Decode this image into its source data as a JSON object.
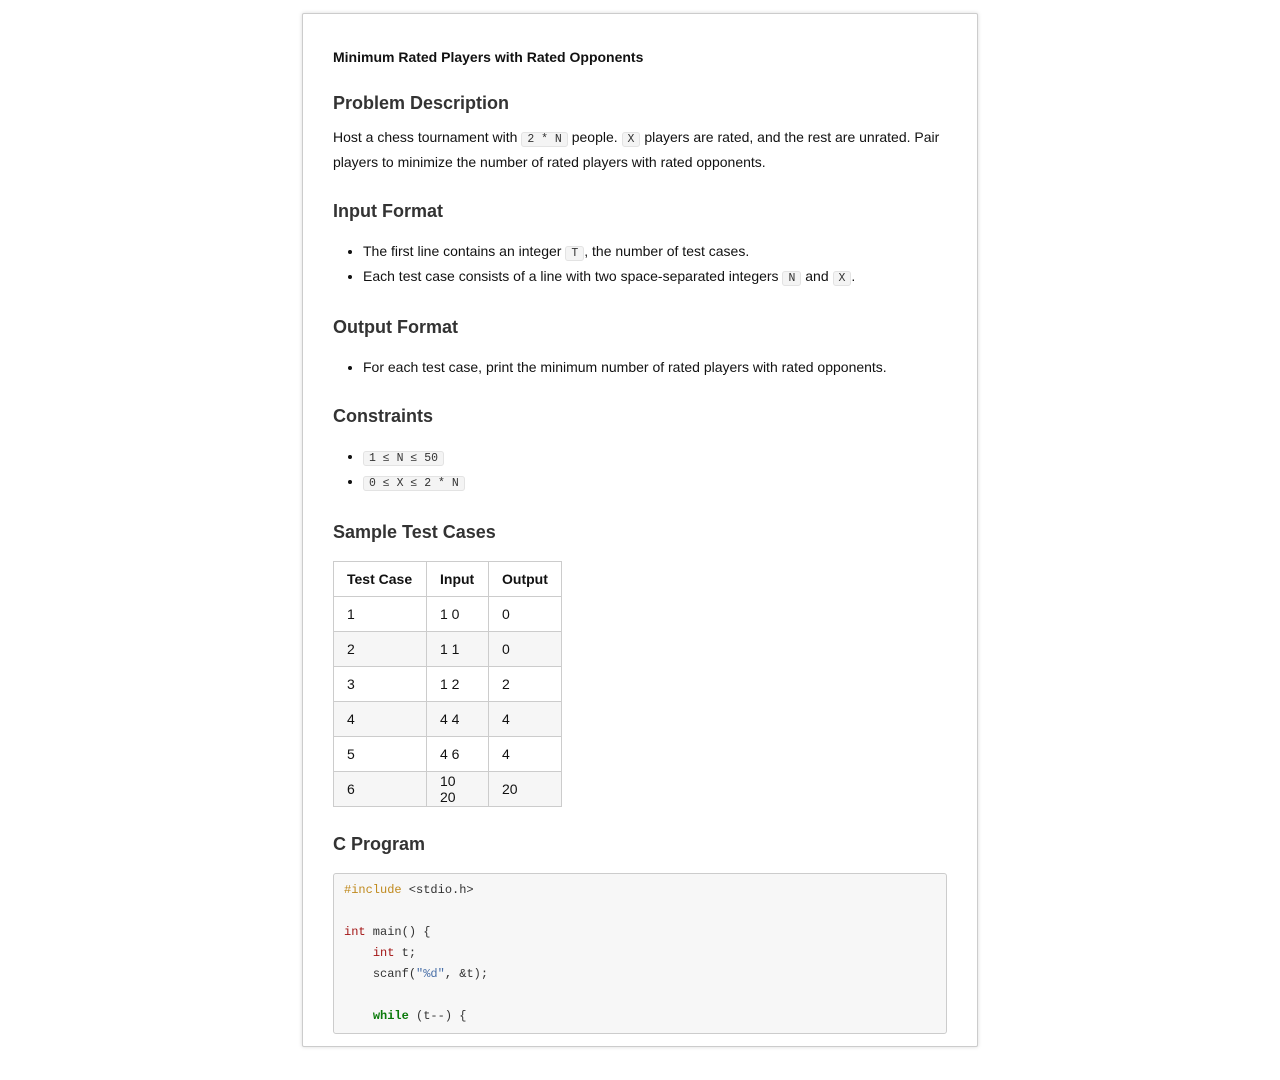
{
  "title": "Minimum Rated Players with Rated Opponents",
  "sections": {
    "description": {
      "heading": "Problem Description",
      "t1": "Host a chess tournament with ",
      "c1": "2 * N",
      "t2": " people. ",
      "c2": "X",
      "t3": " players are rated, and the rest are unrated. Pair players to minimize the number of rated players with rated opponents."
    },
    "input": {
      "heading": "Input Format",
      "b1a": "The first line contains an integer ",
      "b1c": "T",
      "b1b": ", the number of test cases.",
      "b2a": "Each test case consists of a line with two space-separated integers ",
      "b2c1": "N",
      "b2b": " and ",
      "b2c2": "X",
      "b2d": "."
    },
    "output": {
      "heading": "Output Format",
      "b1": "For each test case, print the minimum number of rated players with rated opponents."
    },
    "constraints": {
      "heading": "Constraints",
      "items": [
        "1 ≤ N ≤ 50",
        "0 ≤ X ≤ 2 * N"
      ]
    },
    "samples": {
      "heading": "Sample Test Cases",
      "headers": [
        "Test Case",
        "Input",
        "Output"
      ],
      "rows": [
        [
          "1",
          "1 0",
          "0"
        ],
        [
          "2",
          "1 1",
          "0"
        ],
        [
          "3",
          "1 2",
          "2"
        ],
        [
          "4",
          "4 4",
          "4"
        ],
        [
          "5",
          "4 6",
          "4"
        ],
        [
          "6",
          "10 20",
          "20"
        ]
      ]
    },
    "program": {
      "heading": "C Program",
      "l1a": "#include",
      "l1b": " <stdio.h>",
      "l3a": "int",
      "l3b": " main() {",
      "l4a": "int",
      "l4b": " t;",
      "l5a": "scanf(",
      "l5b": "\"%d\"",
      "l5c": ", &t);",
      "l7a": "while",
      "l7b": " (t--) {"
    }
  }
}
